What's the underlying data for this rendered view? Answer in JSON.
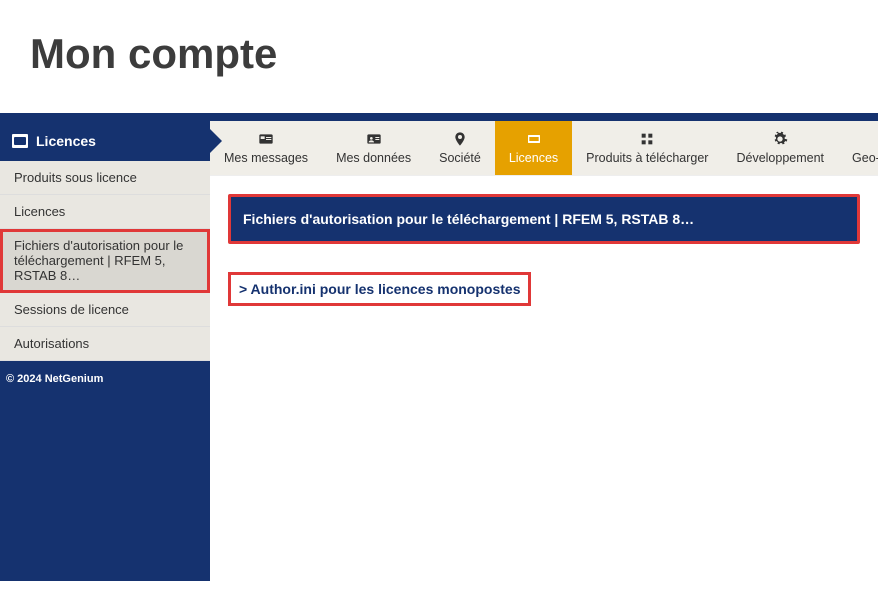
{
  "page": {
    "title": "Mon compte"
  },
  "sidebar": {
    "header": "Licences",
    "items": [
      {
        "label": "Produits sous licence"
      },
      {
        "label": "Licences"
      },
      {
        "label": "Fichiers d'autorisation pour le téléchargement | RFEM 5, RSTAB 8…"
      },
      {
        "label": "Sessions de licence"
      },
      {
        "label": "Autorisations"
      }
    ],
    "footer": "© 2024 NetGenium"
  },
  "tabs": [
    {
      "label": "Mes messages"
    },
    {
      "label": "Mes données"
    },
    {
      "label": "Société"
    },
    {
      "label": "Licences"
    },
    {
      "label": "Produits à télécharger"
    },
    {
      "label": "Développement"
    },
    {
      "label": "Geo-Zone Tool"
    }
  ],
  "content": {
    "banner": "Fichiers d'autorisation pour le téléchargement | RFEM 5, RSTAB 8…",
    "link": "> Author.ini pour les licences monopostes"
  }
}
